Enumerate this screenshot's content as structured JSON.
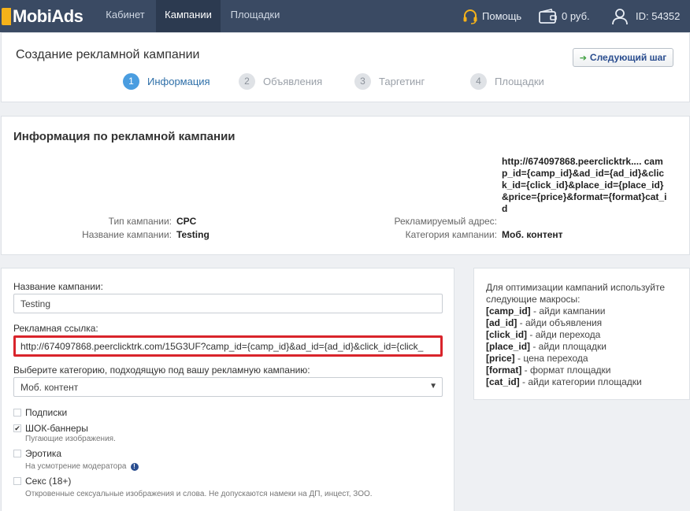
{
  "nav": {
    "logo": "MobiAds",
    "items": [
      "Кабинет",
      "Кампании",
      "Площадки"
    ],
    "help": "Помощь",
    "balance": "0 руб.",
    "user_id": "ID: 54352"
  },
  "header": {
    "title": "Создание рекламной кампании",
    "next_button": "Следующий шаг",
    "steps": [
      {
        "num": "1",
        "label": "Информация"
      },
      {
        "num": "2",
        "label": "Объявления"
      },
      {
        "num": "3",
        "label": "Таргетинг"
      },
      {
        "num": "4",
        "label": "Площадки"
      }
    ]
  },
  "info": {
    "title": "Информация по рекламной кампании",
    "type_label": "Тип кампании:",
    "type_value": "CPC",
    "name_label": "Название кампании:",
    "name_value": "Testing",
    "address_label": "Рекламируемый адрес:",
    "address_value": "http://674097868.peerclicktrk.... camp_id={camp_id}&ad_id={ad_id}&click_id={click_id}&place_id={place_id}&price={price}&format={format}cat_id",
    "category_label": "Категория кампании:",
    "category_value": "Моб. контент"
  },
  "form": {
    "name_label": "Название кампании:",
    "name_value": "Testing",
    "link_label": "Рекламная ссылка:",
    "link_value": "http://674097868.peerclicktrk.com/15G3UF?camp_id={camp_id}&ad_id={ad_id}&click_id={click_",
    "category_label": "Выберите категорию, подходящую под вашу рекламную кампанию:",
    "category_value": "Моб. контент",
    "options": [
      {
        "label": "Подписки",
        "checked": false,
        "hint": ""
      },
      {
        "label": "ШОК-баннеры",
        "checked": true,
        "hint": "Пугающие изображения."
      },
      {
        "label": "Эротика",
        "checked": false,
        "hint": "На усмотрение модератора"
      },
      {
        "label": "Секс (18+)",
        "checked": false,
        "hint": "Откровенные сексуальные изображения и слова. Не допускаются намеки на ДП, инцест, ЗОО."
      }
    ]
  },
  "macros": {
    "intro": "Для оптимизации кампаний используйте следующие макросы:",
    "items": [
      {
        "key": "[camp_id]",
        "desc": " - айди кампании"
      },
      {
        "key": "[ad_id]",
        "desc": " - айди объявления"
      },
      {
        "key": "[click_id]",
        "desc": " - айди перехода"
      },
      {
        "key": "[place_id]",
        "desc": " - айди площадки"
      },
      {
        "key": "[price]",
        "desc": " - цена перехода"
      },
      {
        "key": "[format]",
        "desc": " - формат площадки"
      },
      {
        "key": "[cat_id]",
        "desc": " - айди категории площадки"
      }
    ]
  },
  "colors": {
    "nav_bg": "#3a4a63",
    "accent": "#4a9de0",
    "highlight_border": "#d9242b",
    "logo": "#f5b21a"
  }
}
